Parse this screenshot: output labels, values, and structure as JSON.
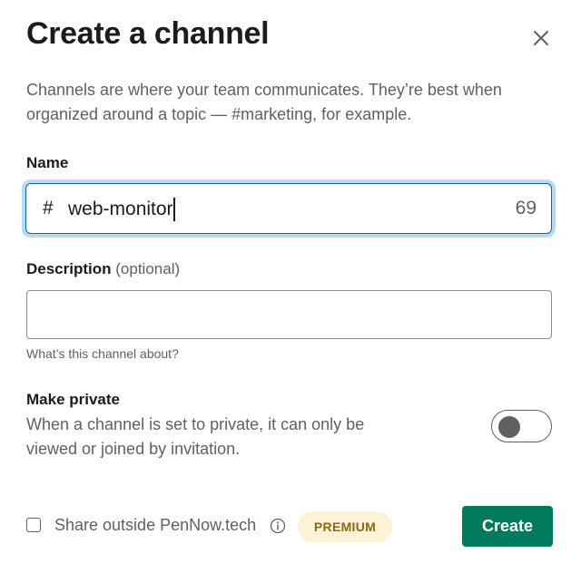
{
  "dialog": {
    "title": "Create a channel",
    "close_icon": "close-icon",
    "intro": "Channels are where your team communicates. They’re best when organized around a topic — #marketing, for example."
  },
  "name_field": {
    "label": "Name",
    "prefix": "#",
    "value": "web-monitor",
    "remaining_chars": "69"
  },
  "description_field": {
    "label": "Description",
    "optional_label": "(optional)",
    "value": "",
    "hint": "What’s this channel about?"
  },
  "private_section": {
    "label": "Make private",
    "description": "When a channel is set to private, it can only be viewed or joined by invitation.",
    "toggle_on": false
  },
  "footer": {
    "share_label": "Share outside PenNow.tech",
    "share_checked": false,
    "info_icon": "info-icon",
    "premium_badge": "PREMIUM",
    "create_button": "Create"
  },
  "colors": {
    "primary_button": "#007a5a",
    "focus_border": "#1264a3",
    "focus_ring": "#b9d9ee",
    "premium_bg": "#fcf3d7",
    "premium_text": "#8a6a10"
  }
}
